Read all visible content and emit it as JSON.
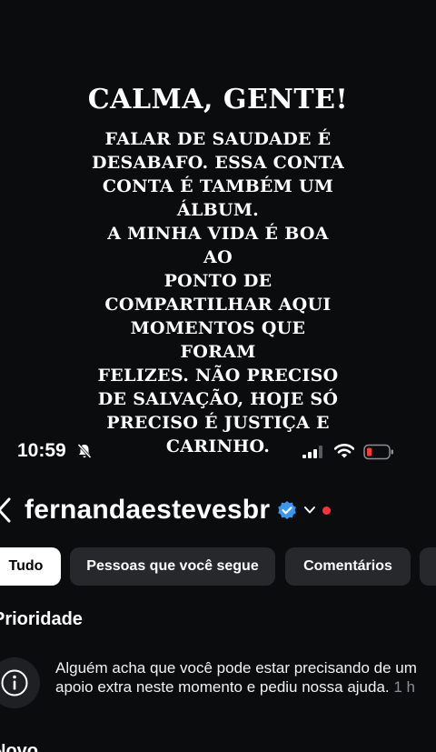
{
  "story_overlay": {
    "title": "CALMA, GENTE!",
    "lines": [
      "FALAR DE SAUDADE É",
      "DESABAFO. ESSA CONTA",
      "CONTA É TAMBÉM UM",
      "ÁLBUM.",
      "A MINHA VIDA É BOA AO",
      "PONTO DE",
      "COMPARTILHAR AQUI",
      "MOMENTOS QUE FORAM",
      "FELIZES. NÃO PRECISO",
      "DE SALVAÇÃO, HOJE SÓ",
      "PRECISO É JUSTIÇA E",
      "CARINHO."
    ]
  },
  "status_bar": {
    "time": "10:59",
    "icons": [
      "bell-muted-icon",
      "cellular-signal-icon",
      "wifi-icon",
      "battery-low-icon"
    ],
    "battery_color": "#ff3b30"
  },
  "header": {
    "back_icon": "chevron-left-icon",
    "username": "fernandaestevesbr",
    "verified_color": "#3897f0",
    "notification_dot_color": "#ff3040"
  },
  "filters": {
    "chips": [
      {
        "label": "Tudo",
        "active": true
      },
      {
        "label": "Pessoas que você segue",
        "active": false
      },
      {
        "label": "Comentários",
        "active": false
      },
      {
        "label": "",
        "active": false
      }
    ]
  },
  "sections": {
    "priority_heading": "Prioridade",
    "new_heading": "Novo"
  },
  "notification": {
    "icon": "info-icon",
    "text": "Alguém acha que você pode estar precisando de um apoio extra neste momento e pediu nossa ajuda.",
    "time": "1 h"
  }
}
